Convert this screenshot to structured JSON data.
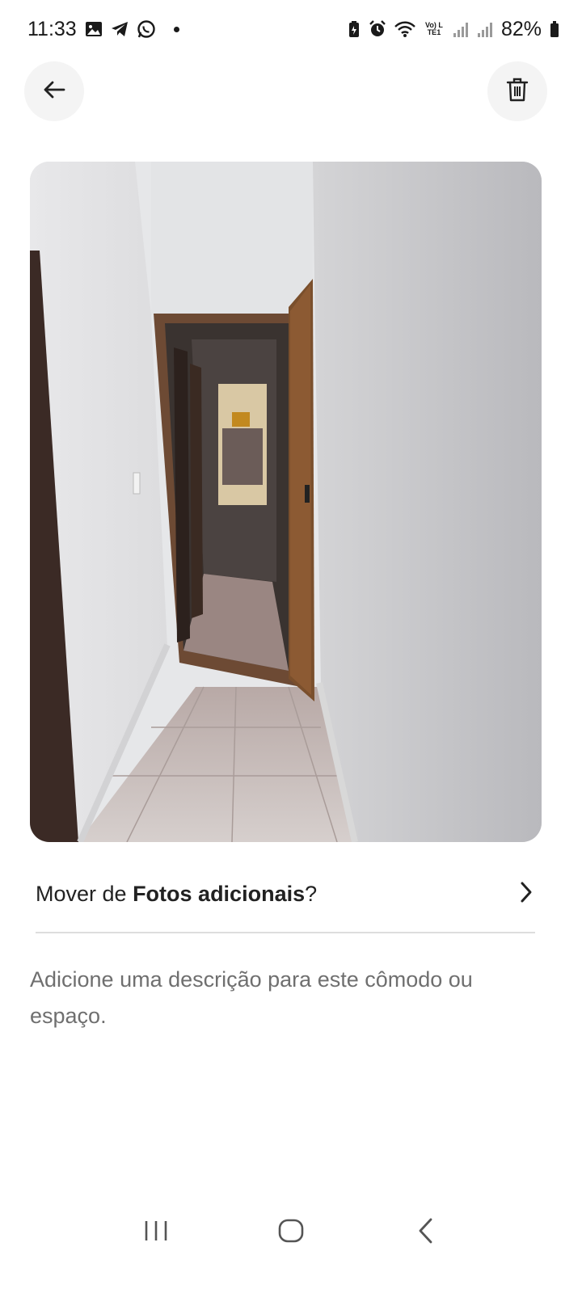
{
  "status_bar": {
    "time": "11:33",
    "battery_percent": "82%",
    "network_label": "Vo) LTE1",
    "left_icons": [
      "gallery-icon",
      "telegram-icon",
      "whatsapp-icon",
      "dot-icon"
    ],
    "right_icons": [
      "battery-saver-icon",
      "alarm-icon",
      "wifi-icon",
      "signal-icon",
      "signal-icon",
      "battery-icon"
    ]
  },
  "toolbar": {
    "back_icon": "arrow-left-icon",
    "delete_icon": "trash-icon"
  },
  "photo": {
    "subject": "hallway-photo"
  },
  "move_row": {
    "prefix": "Mover de ",
    "album": "Fotos adicionais",
    "suffix": "?",
    "chevron_icon": "chevron-right-icon"
  },
  "description": {
    "placeholder": "Adicione uma descrição para este cômodo ou espaço."
  },
  "navigation_bar": {
    "icons": [
      "recent-apps-icon",
      "home-icon",
      "back-icon"
    ]
  },
  "colors": {
    "background": "#ffffff",
    "button_background": "#f4f4f4",
    "text_primary": "#222222",
    "text_secondary": "#6f6f6f",
    "divider": "#dddddd"
  }
}
